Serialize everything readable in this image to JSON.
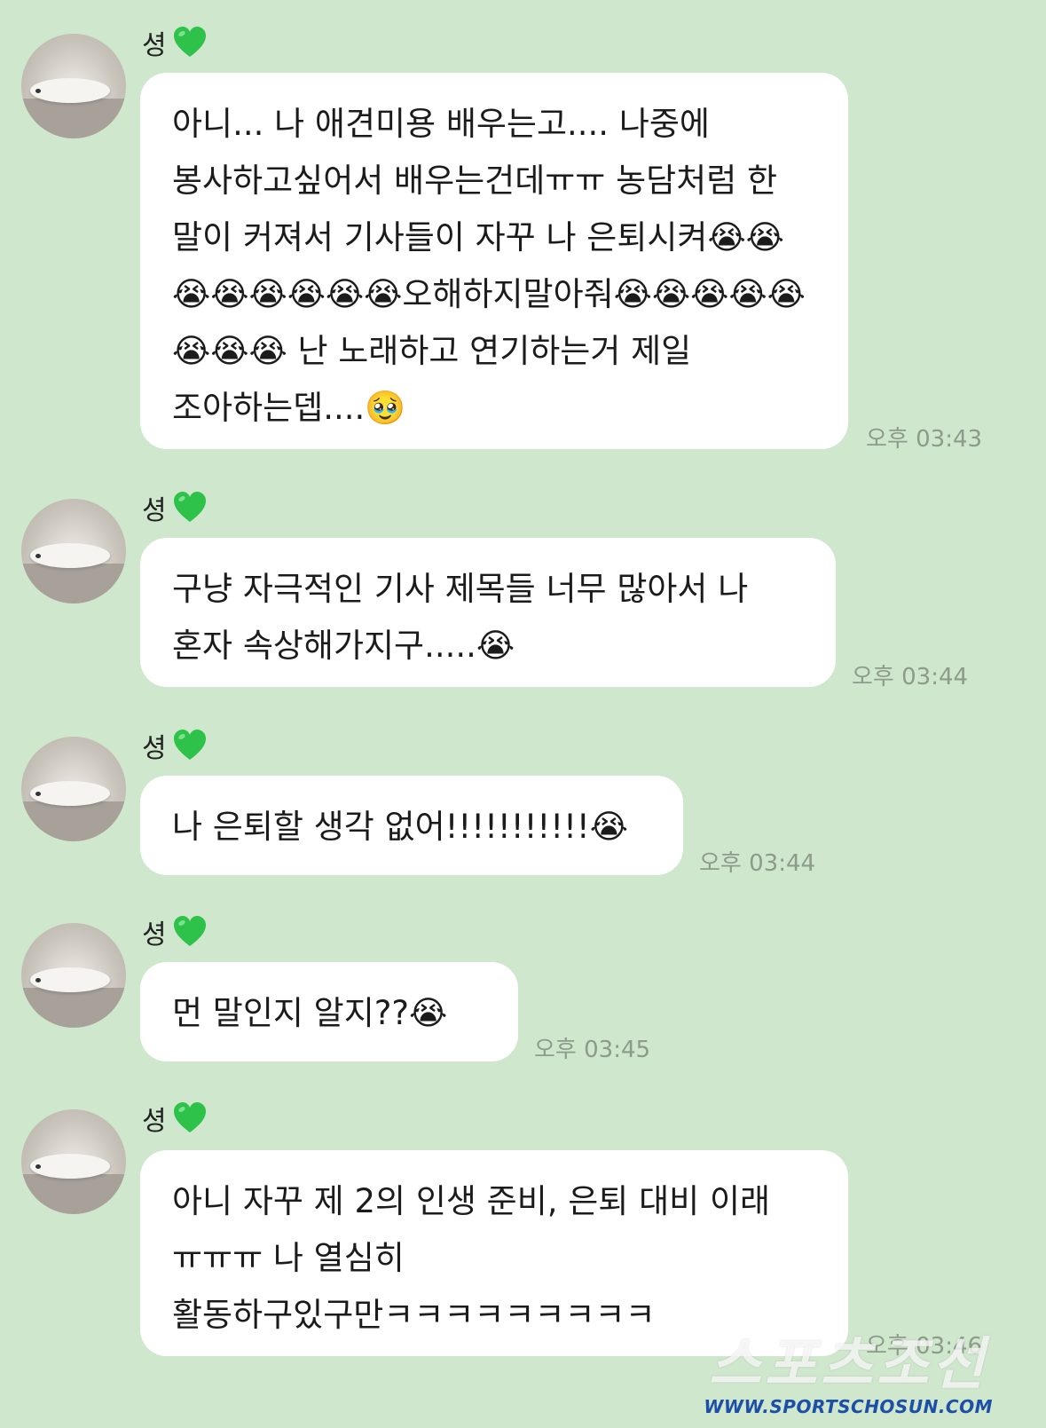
{
  "messages": [
    {
      "sender": "셩",
      "text": "아니... 나 애견미용 배우는고.... 나중에 봉사하고싶어서 배우는건데ㅠㅠ 농담처럼 한 말이 커져서 기사들이 자꾸 나 은퇴시켜😭😭😭😭😭😭😭😭오해하지말아줘😭😭😭😭😭😭😭😭 난 노래하고 연기하는거 제일 조아하는뎁....🥹",
      "time": "오후 03:43"
    },
    {
      "sender": "셩",
      "text": "구냥 자극적인 기사 제목들 너무 많아서 나 혼자 속상해가지구.....😭",
      "time": "오후 03:44"
    },
    {
      "sender": "셩",
      "text": "나 은퇴할 생각 없어!!!!!!!!!!!😭",
      "time": "오후 03:44"
    },
    {
      "sender": "셩",
      "text": "먼 말인지 알지??😭",
      "time": "오후 03:45"
    },
    {
      "sender": "셩",
      "text": "아니 자꾸 제 2의 인생 준비, 은퇴 대비 이래 ㅠㅠㅠ 나 열심히 활동하구있구만ㅋㅋㅋㅋㅋㅋㅋㅋㅋ",
      "time": "오후 03:46"
    }
  ],
  "watermark": {
    "logo": "스포츠조선",
    "url": "WWW.SPORTSCHOSUN.COM"
  },
  "colors": {
    "background": "#cfe7cc",
    "bubble": "#ffffff",
    "heart": "#2ec24a",
    "time": "#8c9b8a"
  },
  "icons": {
    "sender_suffix": "green-heart-icon",
    "avatar": "sleeping-dog-avatar"
  }
}
